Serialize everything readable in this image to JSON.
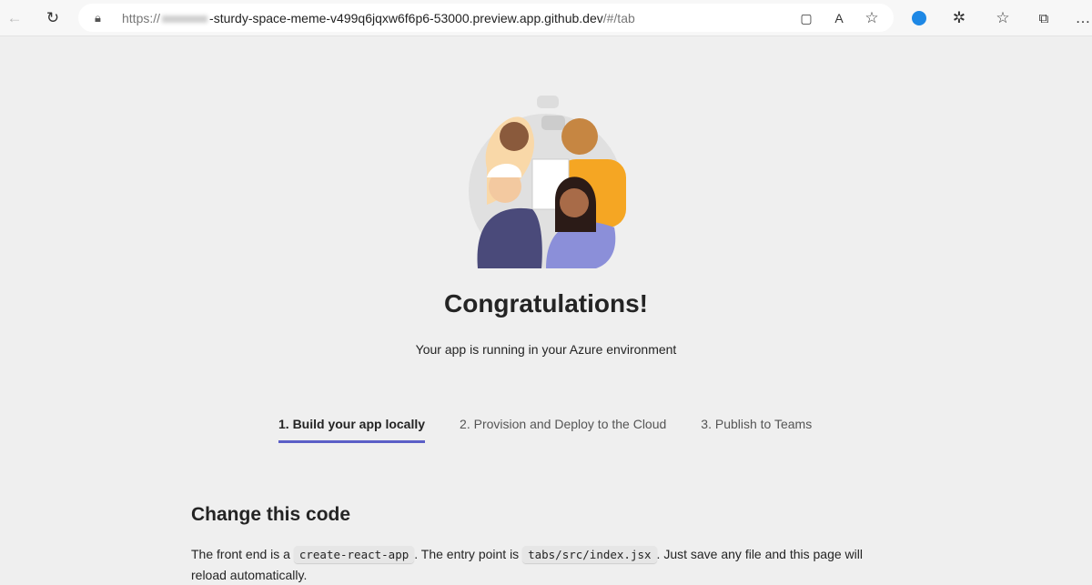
{
  "browser": {
    "url_prefix": "https://",
    "url_main": "-sturdy-space-meme-v499q6jqxw6f6p6-53000.preview.app.github.dev",
    "url_suffix": "/#/tab"
  },
  "page": {
    "title": "Congratulations!",
    "subtitle": "Your app is running in your Azure environment",
    "tabs": [
      {
        "label": "1. Build your app locally",
        "active": true
      },
      {
        "label": "2. Provision and Deploy to the Cloud",
        "active": false
      },
      {
        "label": "3. Publish to Teams",
        "active": false
      }
    ],
    "section_title": "Change this code",
    "para": {
      "t1": "The front end is a ",
      "c1": "create-react-app",
      "t2": ". The entry point is ",
      "c2": "tabs/src/index.jsx",
      "t3": ". Just save any file and this page will reload automatically."
    }
  },
  "colors": {
    "accent": "#5b5fc7"
  }
}
